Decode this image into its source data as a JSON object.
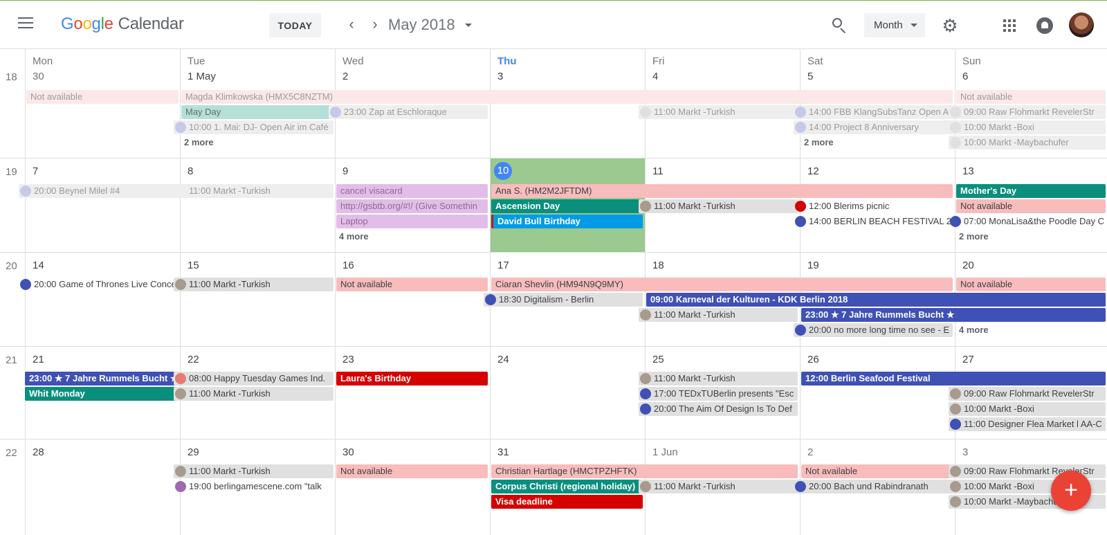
{
  "app": {
    "logo_google": "Google",
    "logo_calendar": "Calendar"
  },
  "header": {
    "today_label": "TODAY",
    "prev_glyph": "‹",
    "next_glyph": "›",
    "month_title": "May 2018",
    "view_label": "Month",
    "icons": [
      "menu-icon",
      "search-icon",
      "gear-icon",
      "apps-icon",
      "bell-icon"
    ]
  },
  "day_names": [
    "Mon",
    "Tue",
    "Wed",
    "Thu",
    "Fri",
    "Sat",
    "Sun"
  ],
  "weeks": [
    {
      "num": "18",
      "days": [
        "30",
        "1 May",
        "2",
        "3",
        "4",
        "5",
        "6"
      ]
    },
    {
      "num": "19",
      "days": [
        "7",
        "8",
        "9",
        "10",
        "11",
        "12",
        "13"
      ]
    },
    {
      "num": "20",
      "days": [
        "14",
        "15",
        "16",
        "17",
        "18",
        "19",
        "20"
      ]
    },
    {
      "num": "21",
      "days": [
        "21",
        "22",
        "23",
        "24",
        "25",
        "26",
        "27"
      ]
    },
    {
      "num": "22",
      "days": [
        "28",
        "29",
        "30",
        "31",
        "1 Jun",
        "2",
        "3"
      ]
    }
  ],
  "today": {
    "week": 1,
    "day": 3,
    "label": "10"
  },
  "events": {
    "w0_e1": "Not available",
    "w0_e2": "Magda Klimkowska (HMX5C8NZTM)",
    "w0_e3": "Not available",
    "w0_e4": "May Day",
    "w0_e5": "10:00  1. Mai: DJ- Open Air im Café",
    "w0_more_tue": "2 more",
    "w0_e6": "23:00  Zap at Eschloraque",
    "w0_e7": "11:00  Markt -Turkish",
    "w0_e8": "14:00  FBB KlangSubsTanz Open A",
    "w0_e9": "14:00  Project 8 Anniversary",
    "w0_more_sat": "2 more",
    "w0_e10": "09:00  Raw Flohmarkt RevelerStr",
    "w0_e11": "10:00  Markt -Boxi",
    "w0_e12": "10:00  Markt -Maybachufer",
    "w1_e1": "20:00  Beynel Milel #4",
    "w1_e2": "11:00  Markt -Turkish",
    "w1_e3": "cancel visacard",
    "w1_e4": "http://gsbtb.org/#!/ (Give Somethin",
    "w1_e5": "Laptop",
    "w1_more_wed": "4 more",
    "w1_e6": "Ana S. (HM2M2JFTDM)",
    "w1_e7": "Ascension Day",
    "w1_e8": "David Bull Birthday",
    "w1_e9": "11:00  Markt -Turkish",
    "w1_e10": "12:00  Blerims picnic",
    "w1_e11": "14:00  BERLIN BEACH FESTIVAL 20",
    "w1_e12": "Mother's Day",
    "w1_e13": "Not available",
    "w1_e14": "07:00  MonaLisa&the Poodle Day C",
    "w1_more_sun": "2 more",
    "w2_e1": "20:00  Game of Thrones Live Conce",
    "w2_e2": "11:00  Markt -Turkish",
    "w2_e3": "Not available",
    "w2_e4": "Ciaran Shevlin (HM94N9Q9MY)",
    "w2_e5": "Not available",
    "w2_e6": "18:30  Digitalism - Berlin",
    "w2_e7": "09:00  Karneval der Kulturen - KDK Berlin 2018",
    "w2_e8": "11:00  Markt -Turkish",
    "w2_e9": "23:00  ★ 7 Jahre Rummels Bucht ★",
    "w2_e10": "20:00  no more long time no see - E",
    "w2_more_sun": "4 more",
    "w3_e1": "23:00  ★ 7 Jahre Rummels Bucht ★",
    "w3_e2": "Whit Monday",
    "w3_e3": "08:00  Happy Tuesday Games Ind.",
    "w3_e4": "11:00  Markt -Turkish",
    "w3_e5": "Laura's Birthday",
    "w3_e6": "11:00  Markt -Turkish",
    "w3_e7": "17:00  TEDxTUBerlin presents \"Esc",
    "w3_e8": "20:00  The Aim Of Design Is To Def",
    "w3_e9": "12:00  Berlin Seafood Festival",
    "w3_e10": "09:00  Raw Flohmarkt RevelerStr",
    "w3_e11": "10:00  Markt -Boxi",
    "w3_e12": "11:00  Designer Flea Market l AA-C",
    "w4_e1": "11:00  Markt -Turkish",
    "w4_e2": "19:00  berlingamescene.com \"talk",
    "w4_e3": "Not available",
    "w4_e4": "Christian Hartlage (HMCTPZHFTK)",
    "w4_e5": "Corpus Christi (regional holiday)",
    "w4_e6": "Visa deadline",
    "w4_e7": "11:00  Markt -Turkish",
    "w4_e8": "Not available",
    "w4_e9": "20:00  Bach und Rabindranath",
    "w4_e10": "09:00  Raw Flohmarkt RevelerStr",
    "w4_e11": "10:00  Markt -Boxi",
    "w4_e12": "10:00  Markt -Maybachufer"
  },
  "fab_label": "+",
  "colors": {
    "accent": "#4285f4",
    "today_bg": "#9bc98f",
    "teal": "#0b8f7d",
    "indigo": "#3f51b5",
    "red": "#d50000",
    "pink": "#f8bcbc",
    "fab": "#ea4335"
  }
}
